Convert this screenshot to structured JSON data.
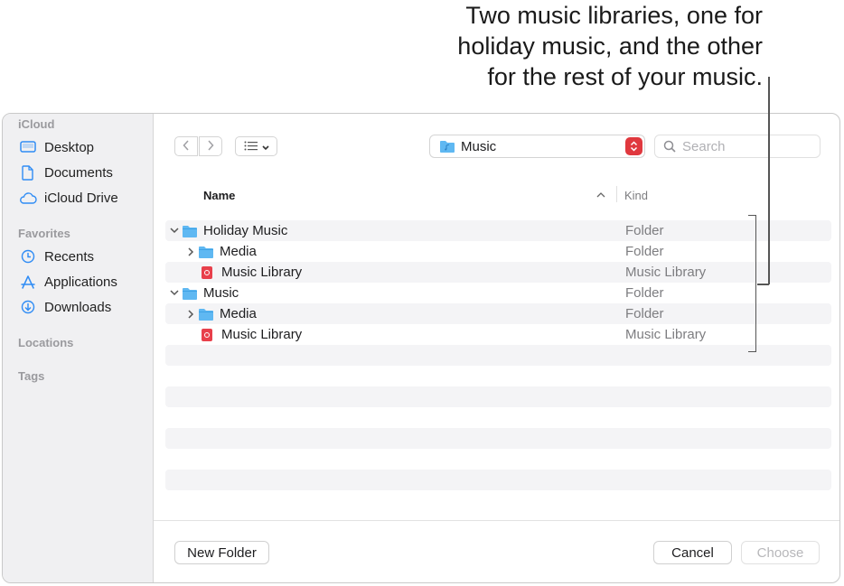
{
  "callout": {
    "lines": [
      "Two music libraries, one for",
      "holiday music, and the other",
      "for the rest of your music."
    ]
  },
  "sidebar": {
    "sections": {
      "icloud": "iCloud",
      "favorites": "Favorites",
      "locations": "Locations",
      "tags": "Tags"
    },
    "icloud_items": [
      {
        "label": "Desktop",
        "icon": "desktop-icon"
      },
      {
        "label": "Documents",
        "icon": "document-icon"
      },
      {
        "label": "iCloud Drive",
        "icon": "cloud-icon"
      }
    ],
    "favorite_items": [
      {
        "label": "Recents",
        "icon": "clock-icon"
      },
      {
        "label": "Applications",
        "icon": "applications-icon"
      },
      {
        "label": "Downloads",
        "icon": "download-icon"
      }
    ]
  },
  "toolbar": {
    "path_label": "Music",
    "search_placeholder": "Search"
  },
  "columns": {
    "name": "Name",
    "kind": "Kind"
  },
  "rows": [
    {
      "name": "Holiday Music",
      "kind": "Folder",
      "level": 0,
      "expanded": true,
      "type": "folder"
    },
    {
      "name": "Media",
      "kind": "Folder",
      "level": 1,
      "expanded": false,
      "type": "folder"
    },
    {
      "name": "Music Library",
      "kind": "Music Library",
      "level": 1,
      "type": "library"
    },
    {
      "name": "Music",
      "kind": "Folder",
      "level": 0,
      "expanded": true,
      "type": "folder"
    },
    {
      "name": "Media",
      "kind": "Folder",
      "level": 1,
      "expanded": false,
      "type": "folder"
    },
    {
      "name": "Music Library",
      "kind": "Music Library",
      "level": 1,
      "type": "library"
    }
  ],
  "buttons": {
    "new_folder": "New Folder",
    "cancel": "Cancel",
    "choose": "Choose"
  },
  "colors": {
    "accent": "#2f8cf5",
    "folder": "#5fb8f2",
    "library": "#e8404b",
    "stepper": "#e0383e"
  }
}
